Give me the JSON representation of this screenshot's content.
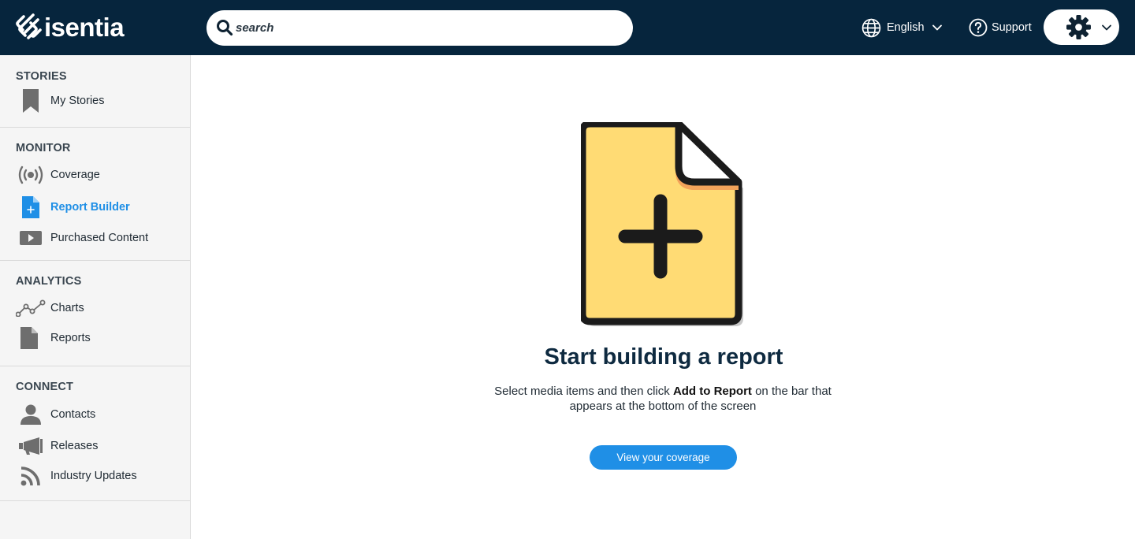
{
  "header": {
    "logo_text": "isentia",
    "search_placeholder": "search",
    "language_label": "English",
    "support_label": "Support"
  },
  "sidebar": {
    "sections": [
      {
        "title": "STORIES",
        "items": [
          {
            "label": "My Stories",
            "icon": "bookmark-icon"
          }
        ]
      },
      {
        "title": "MONITOR",
        "items": [
          {
            "label": "Coverage",
            "icon": "broadcast-icon"
          },
          {
            "label": "Report Builder",
            "icon": "file-plus-icon",
            "active": true
          },
          {
            "label": "Purchased Content",
            "icon": "play-icon"
          }
        ]
      },
      {
        "title": "ANALYTICS",
        "items": [
          {
            "label": "Charts",
            "icon": "line-chart-icon"
          },
          {
            "label": "Reports",
            "icon": "document-icon"
          }
        ]
      },
      {
        "title": "CONNECT",
        "items": [
          {
            "label": "Contacts",
            "icon": "person-icon"
          },
          {
            "label": "Releases",
            "icon": "megaphone-icon"
          },
          {
            "label": "Industry Updates",
            "icon": "rss-icon"
          }
        ]
      }
    ]
  },
  "empty_state": {
    "title": "Start building a report",
    "desc_before": "Select media items and then click ",
    "desc_bold": "Add to Report",
    "desc_after": " on the bar that appears at the bottom of the screen",
    "cta_label": "View your coverage",
    "illustration": "add-document-illustration"
  },
  "colors": {
    "header_bg": "#06253d",
    "accent": "#1f8fe6",
    "illustration_fill": "#ffdb74",
    "illustration_fold": "#f3a35a"
  }
}
